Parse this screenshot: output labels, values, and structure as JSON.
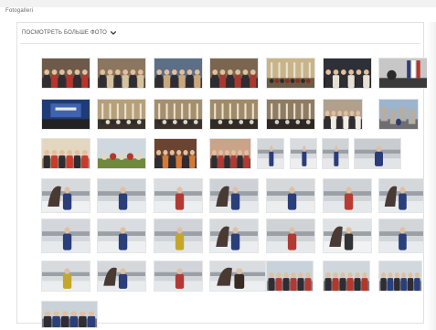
{
  "page": {
    "title": "Fotogalleri"
  },
  "gallery": {
    "toggle_label": "ПОСМОТРЕТЬ БОЛЬШЕ ФОТО",
    "toggle_icon": "chevron-down-icon",
    "photo_count": 44,
    "photos": [
      {
        "theme": "group-indoor",
        "sky": "#6d5a4a",
        "ground": "#3c2e28",
        "figure": "#b8342c"
      },
      {
        "theme": "group-indoor",
        "sky": "#8b7660",
        "ground": "#4a3a2e",
        "figure": "#d4c2a0"
      },
      {
        "theme": "group-indoor",
        "sky": "#5c6f86",
        "ground": "#3b3530",
        "figure": "#c9a77d"
      },
      {
        "theme": "group-indoor",
        "sky": "#7a6650",
        "ground": "#2f2a28",
        "figure": "#a8392f"
      },
      {
        "theme": "hall",
        "sky": "#c9b48a",
        "ground": "#6d5b45",
        "figure": "#8a2d28"
      },
      {
        "theme": "dark-indoor",
        "sky": "#2d3036",
        "ground": "#1c1d20",
        "figure": "#e6e1d4"
      },
      {
        "theme": "flags",
        "sky": "#c7c7c7",
        "ground": "#3a3a3a",
        "figure": "#2b3f7a"
      },
      {
        "theme": "screen",
        "sky": "#1f3c78",
        "ground": "#222",
        "figure": "#e9e9e9"
      },
      {
        "theme": "hall",
        "sky": "#b6a07a",
        "ground": "#3a322a",
        "figure": "#e0dccf"
      },
      {
        "theme": "hall",
        "sky": "#a58f6d",
        "ground": "#3a322a",
        "figure": "#dcd8cc"
      },
      {
        "theme": "hall",
        "sky": "#a08a68",
        "ground": "#322b25",
        "figure": "#d8d4c8"
      },
      {
        "theme": "hall",
        "sky": "#8f7c62",
        "ground": "#2e2722",
        "figure": "#d2cec2"
      },
      {
        "theme": "dark-indoor",
        "sky": "#b0a08c",
        "ground": "#3e3530",
        "figure": "#f0ede5"
      },
      {
        "theme": "city",
        "sky": "#9bb4cf",
        "ground": "#6d6d72",
        "figure": "#2a3b6a"
      },
      {
        "theme": "group-indoor",
        "sky": "#e3d7c0",
        "ground": "#a88c64",
        "figure": "#c93a2f"
      },
      {
        "theme": "outdoor-green",
        "sky": "#cfd8de",
        "ground": "#6f8a3c",
        "figure": "#b4372b"
      },
      {
        "theme": "group-indoor",
        "sky": "#6a4430",
        "ground": "#3a2820",
        "figure": "#d27a3a"
      },
      {
        "theme": "group-indoor",
        "sky": "#caa388",
        "ground": "#6d4c3a",
        "figure": "#b23a34"
      },
      {
        "theme": "winter",
        "sky": "#d2d6d9",
        "ground": "#e8eaec",
        "figure": "#2a3e7a"
      },
      {
        "theme": "winter",
        "sky": "#d8dcdf",
        "ground": "#eceef0",
        "figure": "#2a3e7a"
      },
      {
        "theme": "winter",
        "sky": "#cfd3d6",
        "ground": "#e6e8ea",
        "figure": "#2a3e7a"
      },
      {
        "theme": "winter",
        "sky": "#c9cdd1",
        "ground": "#e2e5e8",
        "figure": "#2b3d79"
      },
      {
        "theme": "winter-sculpture",
        "sky": "#d6dadd",
        "ground": "#eef0f2",
        "figure": "#2a3e7a"
      },
      {
        "theme": "winter",
        "sky": "#cfd4d8",
        "ground": "#e8ebee",
        "figure": "#2a3e7a"
      },
      {
        "theme": "winter",
        "sky": "#dadee1",
        "ground": "#eceff1",
        "figure": "#b23a34"
      },
      {
        "theme": "winter-sculpture",
        "sky": "#ced2d6",
        "ground": "#e6e9ec",
        "figure": "#2a3e7a"
      },
      {
        "theme": "winter",
        "sky": "#d5d9dc",
        "ground": "#ebedef",
        "figure": "#2a3e7a"
      },
      {
        "theme": "winter",
        "sky": "#cfd3d7",
        "ground": "#e5e8eb",
        "figure": "#b93c32"
      },
      {
        "theme": "winter-sculpture",
        "sky": "#d4d8db",
        "ground": "#e9ecee",
        "figure": "#2a3e7a"
      },
      {
        "theme": "winter",
        "sky": "#d3d7db",
        "ground": "#e7eaed",
        "figure": "#2a3e7a"
      },
      {
        "theme": "winter",
        "sky": "#d9dde0",
        "ground": "#edeff1",
        "figure": "#2a3e7a"
      },
      {
        "theme": "winter",
        "sky": "#d0d4d8",
        "ground": "#e4e7ea",
        "figure": "#c4a72a"
      },
      {
        "theme": "winter-sculpture",
        "sky": "#d6dadd",
        "ground": "#ebedef",
        "figure": "#2a3e7a"
      },
      {
        "theme": "winter",
        "sky": "#cfd3d6",
        "ground": "#e6e9ec",
        "figure": "#b23a34"
      },
      {
        "theme": "winter-sculpture",
        "sky": "#e0e3e6",
        "ground": "#f0f2f4",
        "figure": "#333"
      },
      {
        "theme": "winter",
        "sky": "#d2d6d9",
        "ground": "#e8ebed",
        "figure": "#2a3e7a"
      },
      {
        "theme": "winter",
        "sky": "#d7dbde",
        "ground": "#ebeef0",
        "figure": "#c4a72a"
      },
      {
        "theme": "winter-sculpture",
        "sky": "#d4d8db",
        "ground": "#e9ecee",
        "figure": "#2a3e7a"
      },
      {
        "theme": "winter",
        "sky": "#d1d5d9",
        "ground": "#e6e9ec",
        "figure": "#b23a34"
      },
      {
        "theme": "winter-sculpture",
        "sky": "#d9dde0",
        "ground": "#ecefF1",
        "figure": "#3b2a24"
      },
      {
        "theme": "group-outdoor",
        "sky": "#c7d2dc",
        "ground": "#8d8d90",
        "figure": "#b23a34"
      },
      {
        "theme": "group-outdoor",
        "sky": "#cfd6dc",
        "ground": "#7c7f85",
        "figure": "#b4372b"
      },
      {
        "theme": "group-outdoor",
        "sky": "#d1d8de",
        "ground": "#8a8c90",
        "figure": "#2a3e7a"
      },
      {
        "theme": "group-outdoor",
        "sky": "#cad2d9",
        "ground": "#7a7c82",
        "figure": "#2a3e7a"
      },
      {
        "theme": "group-outdoor",
        "sky": "#d0d7dd",
        "ground": "#8a8d92",
        "figure": "#b23a34"
      }
    ]
  }
}
